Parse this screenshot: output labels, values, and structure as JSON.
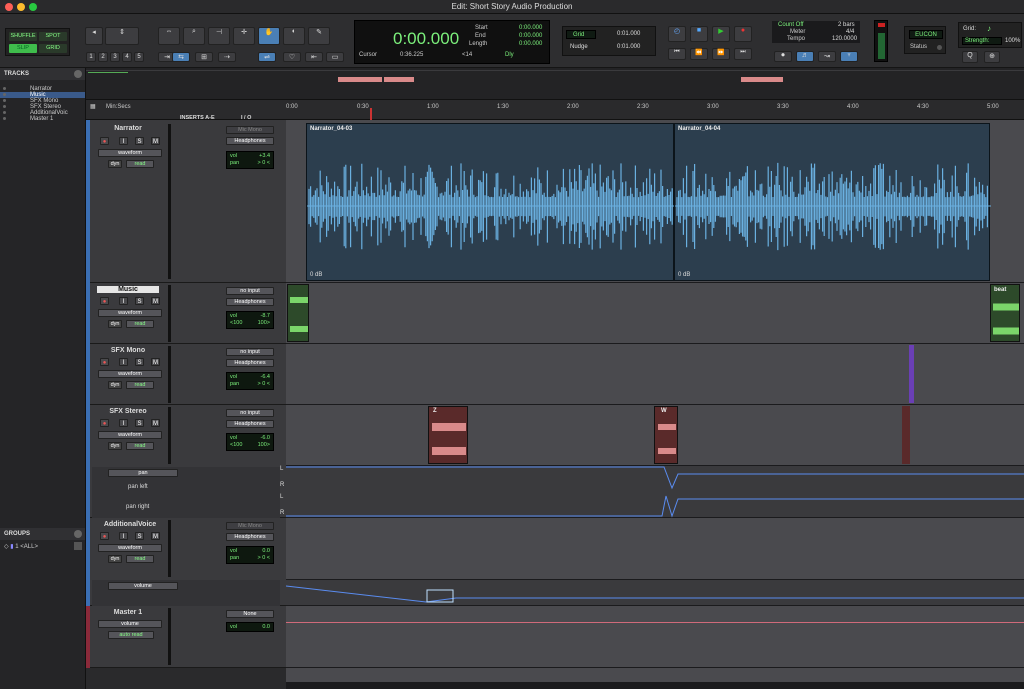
{
  "window": {
    "title": "Edit: Short Story Audio Production"
  },
  "modes": {
    "shuffle": "SHUFFLE",
    "spot": "SPOT",
    "slip": "SLIP",
    "grid": "GRID"
  },
  "counter": {
    "main": "0:00.000",
    "start_label": "Start",
    "end_label": "End",
    "length_label": "Length",
    "start": "0:00.000",
    "end": "0:00.000",
    "length": "0:00.000",
    "cursor_label": "Cursor",
    "cursor": "0:36.225",
    "sync": "<14",
    "dly": "Dly"
  },
  "numbers": [
    "1",
    "2",
    "3",
    "4",
    "5"
  ],
  "grid": {
    "label": "Grid",
    "value": "0:01.000",
    "nudge_label": "Nudge",
    "nudge_value": "0:01.000"
  },
  "count": {
    "count_off": "Count Off",
    "bars": "2 bars",
    "meter_label": "Meter",
    "meter_value": "4/4",
    "tempo_label": "Tempo",
    "tempo_value": "120.0000"
  },
  "eucon": {
    "label": "EUCON",
    "status": "Status"
  },
  "right": {
    "grid_label": "Grid:",
    "strength_label": "Strength:",
    "strength_value": "100%"
  },
  "tracks_panel": {
    "title": "TRACKS",
    "items": [
      "Narrator",
      "Music",
      "SFX Mono",
      "SFX Stereo",
      "AdditionalVoic",
      "Master 1"
    ]
  },
  "groups_panel": {
    "title": "GROUPS",
    "item": "<ALL>"
  },
  "ruler": {
    "label": "Min:Secs",
    "inserts": "INSERTS A-E",
    "io": "I / O",
    "ticks": [
      "0:00",
      "0:30",
      "1:00",
      "1:30",
      "2:00",
      "2:30",
      "3:00",
      "3:30",
      "4:00",
      "4:30",
      "5:00"
    ]
  },
  "tracks": [
    {
      "name": "Narrator",
      "view": "waveform",
      "dyn": "dyn",
      "mode": "read",
      "input": "Mic Mono",
      "output": "Headphones",
      "vol": "+3.4",
      "pan": "> 0 <",
      "clips": [
        "Narrator_04-03",
        "Narrator_04-04"
      ],
      "gain": "0 dB"
    },
    {
      "name": "Music",
      "view": "waveform",
      "dyn": "dyn",
      "mode": "read",
      "input": "no input",
      "output": "Headphones",
      "vol": "-8.7",
      "pan_l": "<100",
      "pan_r": "100>",
      "clip": "beat"
    },
    {
      "name": "SFX Mono",
      "view": "waveform",
      "dyn": "dyn",
      "mode": "read",
      "input": "no input",
      "output": "Headphones",
      "vol": "-6.4",
      "pan": "> 0 <"
    },
    {
      "name": "SFX Stereo",
      "view": "waveform",
      "dyn": "dyn",
      "mode": "read",
      "input": "no input",
      "output": "Headphones",
      "vol": "-6.0",
      "pan_l": "<100",
      "pan_r": "100>",
      "clip1": "Z",
      "clip2": "W",
      "auto": "pan",
      "auto1": "pan left",
      "auto2": "pan right"
    },
    {
      "name": "AdditionalVoice",
      "view": "waveform",
      "dyn": "dyn",
      "mode": "read",
      "input": "Mic Mono",
      "output": "Headphones",
      "vol": "0.0",
      "pan": "> 0 <",
      "auto": "volume"
    },
    {
      "name": "Master 1",
      "view": "volume",
      "mode": "auto read",
      "output": "None",
      "vol": "0.0"
    }
  ],
  "labels": {
    "vol": "vol",
    "pan": "pan",
    "i": "I",
    "s": "S",
    "m": "M",
    "L": "L",
    "R": "R"
  }
}
